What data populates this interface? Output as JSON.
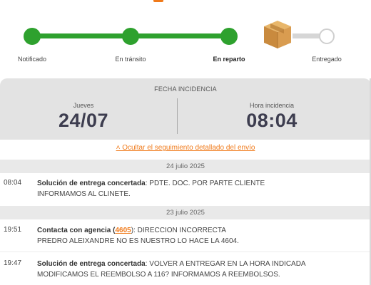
{
  "progress": {
    "steps": [
      {
        "label": "Notificado",
        "status": "done"
      },
      {
        "label": "En tránsito",
        "status": "done"
      },
      {
        "label": "En reparto",
        "status": "current"
      },
      {
        "label": "Entregado",
        "status": "pending"
      }
    ],
    "current_icon": "package-box-icon",
    "colors": {
      "done": "#2ea12e",
      "pending": "#d6d6d6",
      "accent": "#f07a1a"
    }
  },
  "incident": {
    "title": "FECHA INCIDENCIA",
    "day_label": "Jueves",
    "date": "24/07",
    "time_label": "Hora incidencia",
    "time": "08:04"
  },
  "toggle_link": "˄ Ocultar el seguimiento detallado del envío",
  "history": {
    "groups": [
      {
        "date": "24 julio 2025",
        "events": [
          {
            "time": "08:04",
            "title": "Solución de entrega concertada",
            "line1": ": PDTE. DOC. POR PARTE CLIENTE",
            "line2": "INFORMAMOS AL CLINETE."
          }
        ]
      },
      {
        "date": "23 julio 2025",
        "events": [
          {
            "time": "19:51",
            "title": "Contacta con agencia",
            "code_open": " (",
            "code": "4605",
            "line1": "): DIRECCION INCORRECTA",
            "line2": "PREDRO ALEIXANDRE NO ES NUESTRO LO HACE LA 4604."
          },
          {
            "time": "19:47",
            "title": "Solución de entrega concertada",
            "line1": ": VOLVER A ENTREGAR EN LA HORA INDICADA",
            "line2": "MODIFICAMOS EL REEMBOLSO A 116? INFORMAMOS A REEMBOLSOS."
          }
        ]
      }
    ]
  }
}
